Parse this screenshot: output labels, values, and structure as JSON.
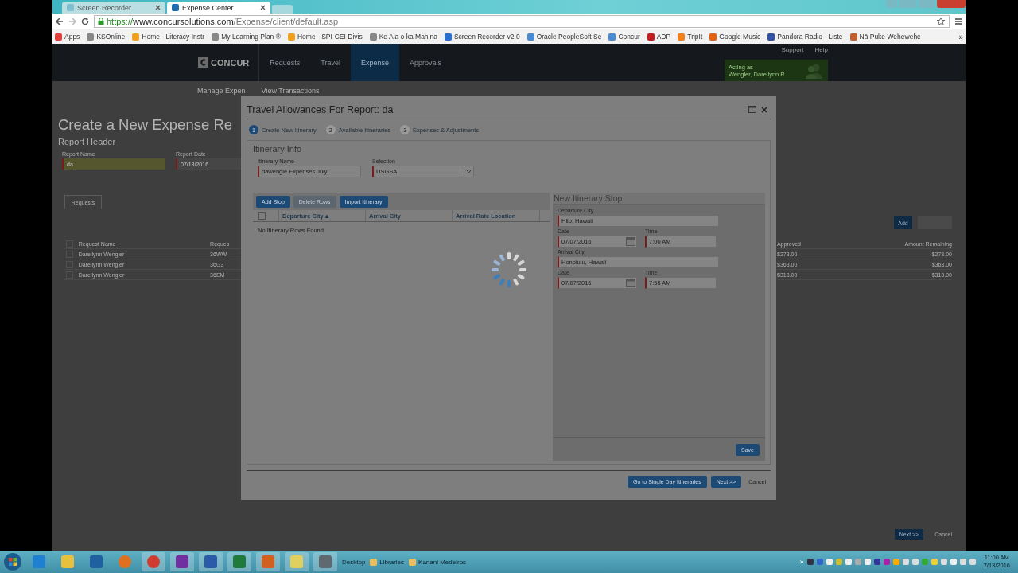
{
  "browser": {
    "tabs": [
      {
        "label": "Screen Recorder",
        "selected": false
      },
      {
        "label": "Expense Center",
        "selected": true
      }
    ],
    "address": {
      "scheme": "https://",
      "host": "www.concursolutions.com",
      "path": "/Expense/client/default.asp"
    },
    "bookmarks": [
      {
        "label": "Apps"
      },
      {
        "label": "KSOnline"
      },
      {
        "label": "Home - Literacy Instr"
      },
      {
        "label": "My Learning Plan ®"
      },
      {
        "label": "Home - SPI-CEI Divis"
      },
      {
        "label": "Ke Ala o ka Mahina"
      },
      {
        "label": "Screen Recorder v2.0"
      },
      {
        "label": "Oracle PeopleSoft Se"
      },
      {
        "label": "Concur"
      },
      {
        "label": "ADP"
      },
      {
        "label": "TripIt"
      },
      {
        "label": "Google Music"
      },
      {
        "label": "Pandora Radio - Liste"
      },
      {
        "label": "Nā Puke Wehewehe"
      }
    ],
    "bookmarks_more": "»"
  },
  "nav": {
    "logo": "CONCUR",
    "items": [
      {
        "label": "Requests",
        "selected": false
      },
      {
        "label": "Travel",
        "selected": false
      },
      {
        "label": "Expense",
        "selected": true
      },
      {
        "label": "Approvals",
        "selected": false
      }
    ],
    "links": [
      "Support",
      "Help"
    ],
    "acting": {
      "label": "Acting as",
      "name": "Wengler, Darellynn R"
    }
  },
  "subnav": [
    "Manage Expen",
    "View Transactions"
  ],
  "page": {
    "title": "Create a New Expense Re",
    "section": "Report Header",
    "fields": [
      {
        "label": "Report Name",
        "value": "da",
        "highlighted": true
      },
      {
        "label": "Report Date",
        "value": "07/13/2016",
        "highlighted": false
      }
    ],
    "tab": "Requests",
    "requests": {
      "header_checked": false,
      "columns": [
        "Request Name",
        "Reques"
      ],
      "rows": [
        {
          "cells": [
            "Darellynn Wengler",
            "36WW"
          ],
          "checked": false
        },
        {
          "cells": [
            "Darellynn Wengler",
            "36G3"
          ],
          "checked": false
        },
        {
          "cells": [
            "Darellynn Wengler",
            "36EM"
          ],
          "checked": false
        }
      ]
    },
    "amounts": {
      "add_button": "Add",
      "columns": [
        "Approved",
        "Amount Remaining"
      ],
      "rows": [
        [
          "$273.00",
          "$273.00"
        ],
        [
          "$363.00",
          "$363.00"
        ],
        [
          "$313.00",
          "$313.00"
        ]
      ]
    },
    "footer_buttons": [
      "Next >>",
      "Cancel"
    ]
  },
  "dialog": {
    "title": "Travel Allowances For Report: da",
    "steps": [
      {
        "number": "1",
        "label": "Create New Itinerary",
        "selected": true
      },
      {
        "number": "2",
        "label": "Available Itineraries",
        "selected": false
      },
      {
        "number": "3",
        "label": "Expenses & Adjustments",
        "selected": false
      }
    ],
    "section": "Itinerary Info",
    "itinerary_name": {
      "label": "Itinerary Name",
      "value": "dawengle Expenses July"
    },
    "selection": {
      "label": "Selection",
      "value": "USGSA"
    },
    "toolbar": [
      {
        "label": "Add Stop",
        "disabled": false
      },
      {
        "label": "Delete Rows",
        "disabled": true
      },
      {
        "label": "Import Itinerary",
        "disabled": false
      }
    ],
    "columns": [
      "Departure City ▴",
      "Arrival City",
      "Arrival Rate Location"
    ],
    "header_checked": false,
    "empty_message": "No Itinerary Rows Found",
    "loading": true,
    "stop": {
      "title": "New Itinerary Stop",
      "rows": [
        [
          {
            "label": "Departure City",
            "value": "Hilo, Hawaii",
            "kind": "text"
          }
        ],
        [
          {
            "label": "Date",
            "value": "07/07/2016",
            "kind": "date"
          },
          {
            "label": "Time",
            "value": "7:00 AM",
            "kind": "time"
          }
        ],
        [
          {
            "label": "Arrival City",
            "value": "Honolulu, Hawaii",
            "kind": "text"
          }
        ],
        [
          {
            "label": "Date",
            "value": "07/07/2016",
            "kind": "date"
          },
          {
            "label": "Time",
            "value": "7:55 AM",
            "kind": "time"
          }
        ]
      ],
      "save_button": "Save"
    },
    "footer_buttons": [
      {
        "label": "Go to Single Day Itineraries",
        "kind": "primary"
      },
      {
        "label": "Next >>",
        "kind": "primary"
      },
      {
        "label": "Cancel",
        "kind": "link"
      }
    ]
  },
  "taskbar": {
    "items": [
      {
        "label": "Desktop"
      },
      {
        "label": "Libraries"
      },
      {
        "label": "Kanani Medeiros"
      }
    ],
    "overflow": "»",
    "time": "11:00 AM",
    "date": "7/13/2016"
  }
}
